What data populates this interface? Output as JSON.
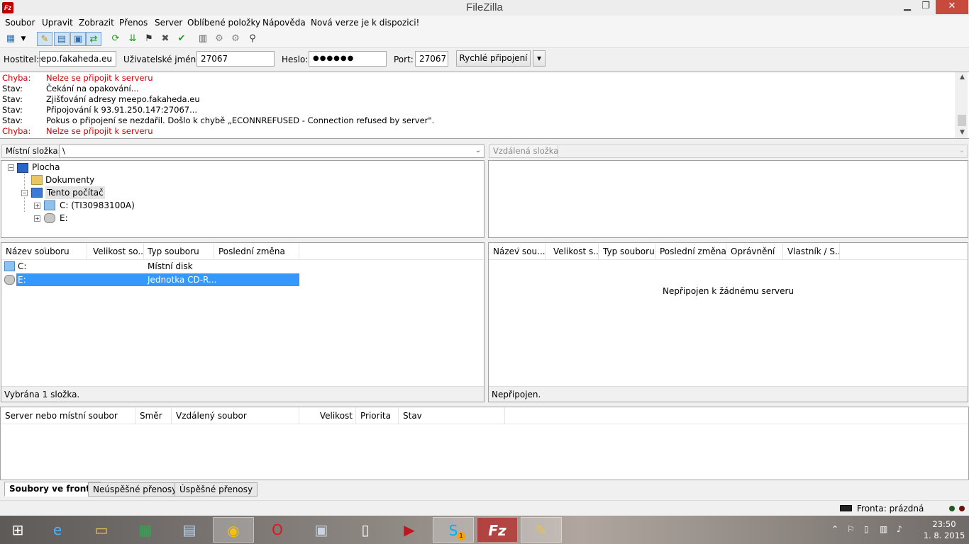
{
  "window": {
    "title": "FileZilla",
    "app_icon": "Fz"
  },
  "menu": [
    "Soubor",
    "Upravit",
    "Zobrazit",
    "Přenos",
    "Server",
    "Oblíbené položky",
    "Nápověda",
    "Nová verze je k dispozici!"
  ],
  "toolbar_icons": [
    "site-manager-icon",
    "dropdown-icon",
    "message-log-icon",
    "local-tree-icon",
    "remote-tree-icon",
    "queue-icon",
    "refresh-icon",
    "process-queue-icon",
    "cancel-icon",
    "disconnect-icon",
    "reconnect-icon",
    "filter-icon",
    "compare-icon",
    "sync-browse-icon",
    "search-icon"
  ],
  "quickconnect": {
    "host_label": "Hostitel:",
    "host_value": "meepo.fakaheda.eu",
    "user_label": "Uživatelské jméno:",
    "user_value": "27067",
    "pass_label": "Heslo:",
    "pass_value": "●●●●●●",
    "port_label": "Port:",
    "port_value": "27067",
    "connect_label": "Rychlé připojení",
    "dropdown_glyph": "▾"
  },
  "log": [
    {
      "type": "Chyba:",
      "text": "Nelze se připojit k serveru",
      "error": true
    },
    {
      "type": "Stav:",
      "text": "Čekání na opakování...",
      "error": false
    },
    {
      "type": "Stav:",
      "text": "Zjišťování adresy meepo.fakaheda.eu",
      "error": false
    },
    {
      "type": "Stav:",
      "text": "Připojování k 93.91.250.147:27067...",
      "error": false
    },
    {
      "type": "Stav:",
      "text": "Pokus o připojení se nezdařil. Došlo k chybě „ECONNREFUSED - Connection refused by server\".",
      "error": false
    },
    {
      "type": "Chyba:",
      "text": "Nelze se připojit k serveru",
      "error": true
    }
  ],
  "local": {
    "path_label": "Místní složka:",
    "path_value": "\\",
    "tree": [
      {
        "label": "Plocha",
        "icon": "desktop-icon"
      },
      {
        "label": "Dokumenty",
        "icon": "documents-icon"
      },
      {
        "label": "Tento počítač",
        "icon": "computer-icon"
      },
      {
        "label": "C: (TI30983100A)",
        "icon": "drive-icon"
      },
      {
        "label": "E:",
        "icon": "cdrom-icon"
      }
    ],
    "columns": [
      "Název souboru",
      "Velikost so...",
      "Typ souboru",
      "Poslední změna"
    ],
    "files": [
      {
        "name": "C:",
        "type": "Místní disk",
        "selected": false,
        "icon": "drive-icon"
      },
      {
        "name": "E:",
        "type": "Jednotka CD-R...",
        "selected": true,
        "icon": "cdrom-icon"
      }
    ],
    "status": "Vybrána 1 složka."
  },
  "remote": {
    "path_label": "Vzdálená složka:",
    "columns": [
      "Název sou...",
      "Velikost s...",
      "Typ souboru",
      "Poslední změna",
      "Oprávnění",
      "Vlastník / S..."
    ],
    "empty_message": "Nepřipojen k žádnému serveru",
    "status": "Nepřipojen."
  },
  "queue": {
    "columns": [
      "Server nebo místní soubor",
      "Směr",
      "Vzdálený soubor",
      "Velikost",
      "Priorita",
      "Stav"
    ]
  },
  "tabs": [
    "Soubory ve frontě",
    "Neúspěšné přenosy",
    "Úspěšné přenosy"
  ],
  "statusbar": {
    "queue_text": "Fronta: prázdná"
  },
  "taskbar": {
    "apps": [
      "windows-start-icon",
      "internet-explorer-icon",
      "file-explorer-icon",
      "store-icon",
      "remote-desktop-icon",
      "chrome-icon",
      "opera-icon",
      "monitor-icon",
      "document-icon",
      "media-player-icon",
      "skype-icon",
      "filezilla-icon",
      "paint-icon"
    ],
    "skype_badge": "1",
    "time": "23:50",
    "date": "1. 8. 2015"
  }
}
